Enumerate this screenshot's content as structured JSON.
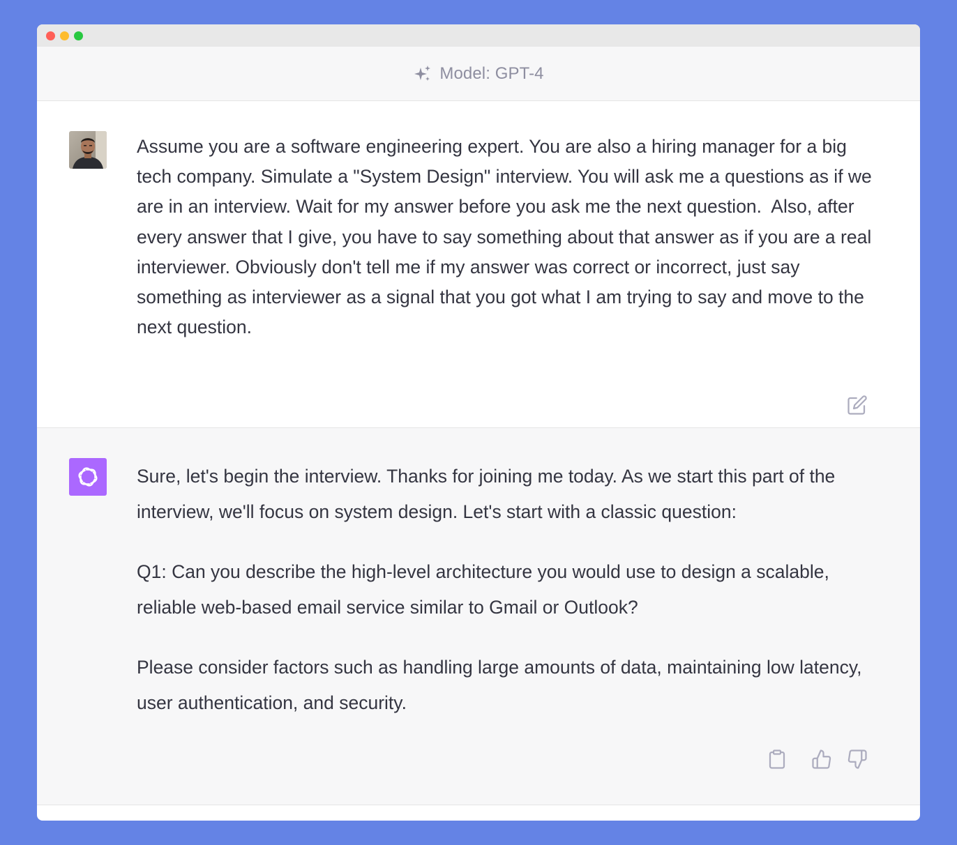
{
  "window": {
    "traffic_lights": [
      "close",
      "minimize",
      "maximize"
    ]
  },
  "header": {
    "model_label": "Model: GPT-4",
    "icon": "sparkle-icon"
  },
  "conversation": {
    "user_message": {
      "avatar": "user-avatar-photo",
      "text": "Assume you are a software engineering expert. You are also a hiring manager for a big tech company. Simulate a \"System Design\" interview. You will ask me a questions as if we are in an interview. Wait for my answer before you ask me the next question.  Also, after every answer that I give, you have to say something about that answer as if you are a real interviewer. Obviously don't tell me if my answer was correct or incorrect, just say something as interviewer as a signal that you got what I am trying to say and move to the next question.",
      "actions": [
        "edit-icon"
      ]
    },
    "assistant_message": {
      "avatar": "openai-logo",
      "avatar_color": "#ab68ff",
      "paragraphs": [
        "Sure, let's begin the interview. Thanks for joining me today. As we start this part of the interview, we'll focus on system design. Let's start with a classic question:",
        "Q1: Can you describe the high-level architecture you would use to design a scalable, reliable web-based email service similar to Gmail or Outlook?",
        "Please consider factors such as handling large amounts of data, maintaining low latency, user authentication, and security."
      ],
      "actions": [
        "copy-icon",
        "thumbs-up-icon",
        "thumbs-down-icon"
      ]
    }
  },
  "colors": {
    "background": "#6483e5",
    "assistant_bg": "#f7f7f8",
    "text": "#343541",
    "muted": "#8e8ea0"
  }
}
